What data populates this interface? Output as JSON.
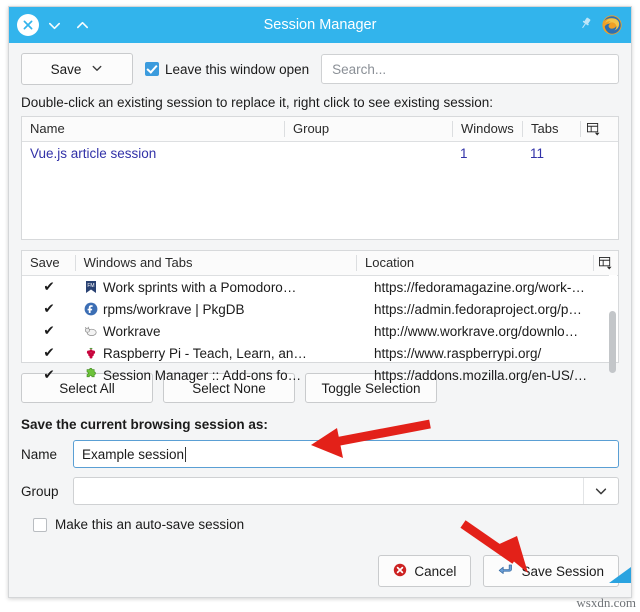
{
  "window": {
    "title": "Session Manager",
    "close_icon": "close-circle-icon",
    "collapse_icon": "chevron-down-icon",
    "expand_icon": "chevron-up-icon",
    "pin_icon": "pin-icon",
    "app_icon": "firefox-icon",
    "titlebar_color": "#32b4ec"
  },
  "toolbar": {
    "save_label": "Save",
    "save_dropdown_icon": "chevron-down-icon",
    "leave_open_label": "Leave this window open",
    "leave_open_checked": true,
    "search_placeholder": "Search..."
  },
  "hint": "Double-click an existing session to replace it, right click to see existing session:",
  "sessions_table": {
    "columns": [
      "Name",
      "Group",
      "Windows",
      "Tabs"
    ],
    "column_picker_icon": "column-picker-icon",
    "rows": [
      {
        "name": "Vue.js article session",
        "group": "",
        "windows": "1",
        "tabs": "11"
      }
    ],
    "link_color": "#3232a8"
  },
  "tabs_table": {
    "columns": [
      "Save",
      "Windows and Tabs",
      "Location"
    ],
    "column_picker_icon": "column-picker-icon",
    "rows": [
      {
        "save": "✔",
        "favicon": "fedora-magazine-icon",
        "title": "Work sprints with a Pomodoro…",
        "location": "https://fedoramagazine.org/work-…"
      },
      {
        "save": "✔",
        "favicon": "fedora-icon",
        "title": "rpms/workrave | PkgDB",
        "location": "https://admin.fedoraproject.org/p…"
      },
      {
        "save": "✔",
        "favicon": "workrave-icon",
        "title": "Workrave",
        "location": "http://www.workrave.org/downlo…"
      },
      {
        "save": "✔",
        "favicon": "raspberry-pi-icon",
        "title": "Raspberry Pi - Teach, Learn, an…",
        "location": "https://www.raspberrypi.org/"
      },
      {
        "save": "✔",
        "favicon": "puzzle-piece-icon",
        "title": "Session Manager :: Add-ons fo…",
        "location": "https://addons.mozilla.org/en-US/…"
      }
    ]
  },
  "selection_buttons": {
    "select_all": "Select All",
    "select_none": "Select None",
    "toggle_selection": "Toggle Selection"
  },
  "save_form": {
    "heading": "Save the current browsing session as:",
    "name_label": "Name",
    "name_value": "Example session",
    "group_label": "Group",
    "group_value": "",
    "group_dropdown_icon": "chevron-down-icon",
    "autosave_label": "Make this an auto-save session",
    "autosave_checked": false
  },
  "footer": {
    "cancel_label": "Cancel",
    "cancel_icon": "error-circle-icon",
    "save_session_label": "Save Session",
    "save_session_icon": "enter-arrow-icon"
  },
  "annotations": {
    "arrow_color": "#e32119",
    "arrow_heading": "arrow-pointing-to-heading",
    "arrow_save_session": "arrow-pointing-to-save-session"
  },
  "watermark": "wsxdn.com"
}
